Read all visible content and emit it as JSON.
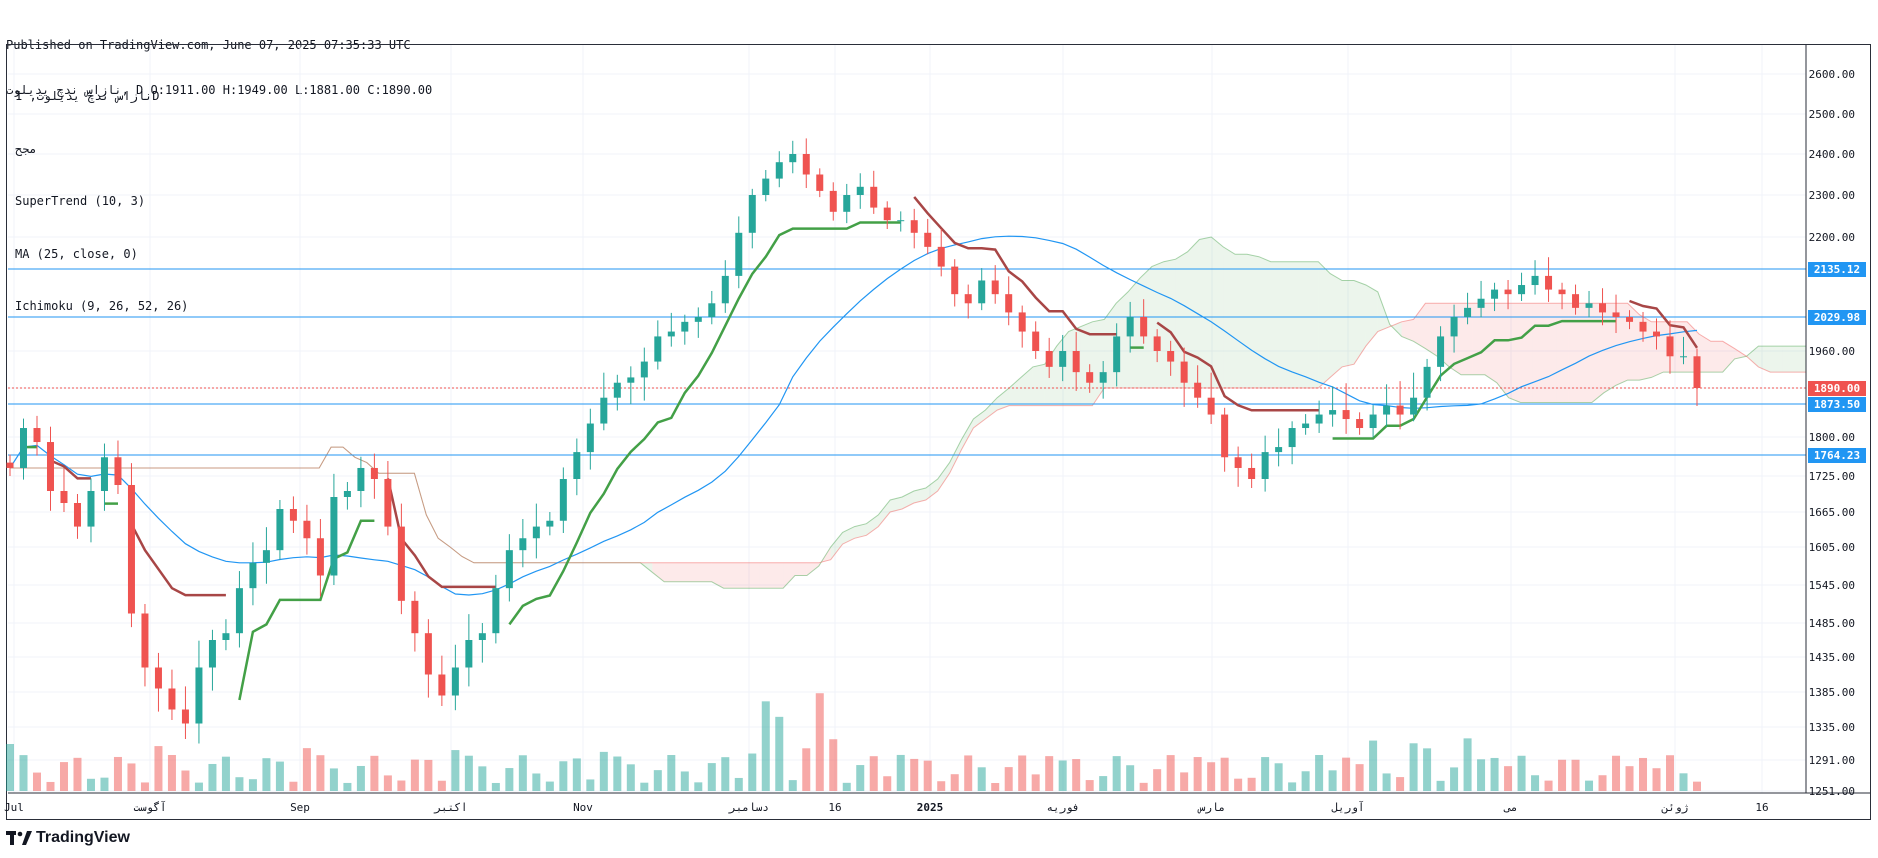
{
  "header": {
    "line1": "Published on TradingView.com, June 07, 2025 07:35:33 UTC",
    "line2": "نازاس ندچ یدیلوت, D O:1911.00 H:1949.00 L:1881.00 C:1890.00"
  },
  "legend": {
    "symbol": "نازاس ندچ یدیلوت, 1D",
    "item2": "مجح",
    "item3": "SuperTrend (10, 3)",
    "item4": "MA (25, close, 0)",
    "item5": "Ichimoku (9, 26, 52, 26)"
  },
  "footer": {
    "brand": "TradingView"
  },
  "colors": {
    "up": "#26a69a",
    "down": "#ef5350",
    "supertrend_up": "#43a047",
    "supertrend_down": "#a84646",
    "ma": "#2196f3",
    "level": "#2196f3"
  },
  "chart_data": {
    "type": "candlestick",
    "title": "",
    "ylim": [
      1220,
      2660
    ],
    "y_ticks": [
      "2600.00",
      "2500.00",
      "2400.00",
      "2300.00",
      "2200.00",
      "2135.12",
      "2029.98",
      "1960.00",
      "1890.00",
      "1873.50",
      "1800.00",
      "1764.23",
      "1725.00",
      "1665.00",
      "1605.00",
      "1545.00",
      "1485.00",
      "1435.00",
      "1385.00",
      "1335.00",
      "1291.00",
      "1251.00"
    ],
    "x_labels": [
      "Jul",
      "آگوست",
      "Sep",
      "اکتبر",
      "Nov",
      "دسامبر",
      "16",
      "2025",
      "فوریه",
      "مارس",
      "آوریل",
      "می",
      "ژوئن",
      "16"
    ],
    "horizontal_levels": [
      {
        "value": 2135.12,
        "label": "2135.12"
      },
      {
        "value": 2029.98,
        "label": "2029.98"
      },
      {
        "value": 1873.5,
        "label": "1873.50"
      },
      {
        "value": 1764.23,
        "label": "1764.23"
      }
    ],
    "last_price": {
      "value": 1890.0,
      "label": "1890.00"
    },
    "candles_close_approx": [
      1740,
      1820,
      1790,
      1700,
      1680,
      1640,
      1700,
      1760,
      1710,
      1500,
      1420,
      1390,
      1360,
      1340,
      1420,
      1460,
      1470,
      1540,
      1580,
      1600,
      1670,
      1650,
      1620,
      1560,
      1690,
      1700,
      1740,
      1720,
      1640,
      1520,
      1470,
      1410,
      1380,
      1420,
      1460,
      1470,
      1540,
      1600,
      1620,
      1640,
      1650,
      1720,
      1770,
      1830,
      1880,
      1900,
      1910,
      1940,
      1990,
      2000,
      2020,
      2030,
      2060,
      2120,
      2210,
      2300,
      2340,
      2380,
      2400,
      2350,
      2310,
      2260,
      2300,
      2320,
      2270,
      2240,
      2240,
      2210,
      2180,
      2140,
      2080,
      2060,
      2110,
      2080,
      2040,
      2000,
      1960,
      1930,
      1960,
      1920,
      1900,
      1920,
      1990,
      2030,
      1990,
      1960,
      1940,
      1900,
      1880,
      1850,
      1760,
      1740,
      1720,
      1770,
      1780,
      1820,
      1830,
      1850,
      1860,
      1840,
      1820,
      1850,
      1870,
      1850,
      1880,
      1930,
      1990,
      2030,
      2050,
      2070,
      2090,
      2080,
      2100,
      2120,
      2090,
      2080,
      2050,
      2060,
      2040,
      2030,
      2020,
      2000,
      1990,
      1950,
      1950,
      1890
    ],
    "volume": {
      "ylim": [
        0,
        900000
      ]
    },
    "series": [
      {
        "name": "SuperTrend (10, 3)"
      },
      {
        "name": "MA (25, close, 0)"
      },
      {
        "name": "Ichimoku (9, 26, 52, 26)"
      }
    ]
  }
}
